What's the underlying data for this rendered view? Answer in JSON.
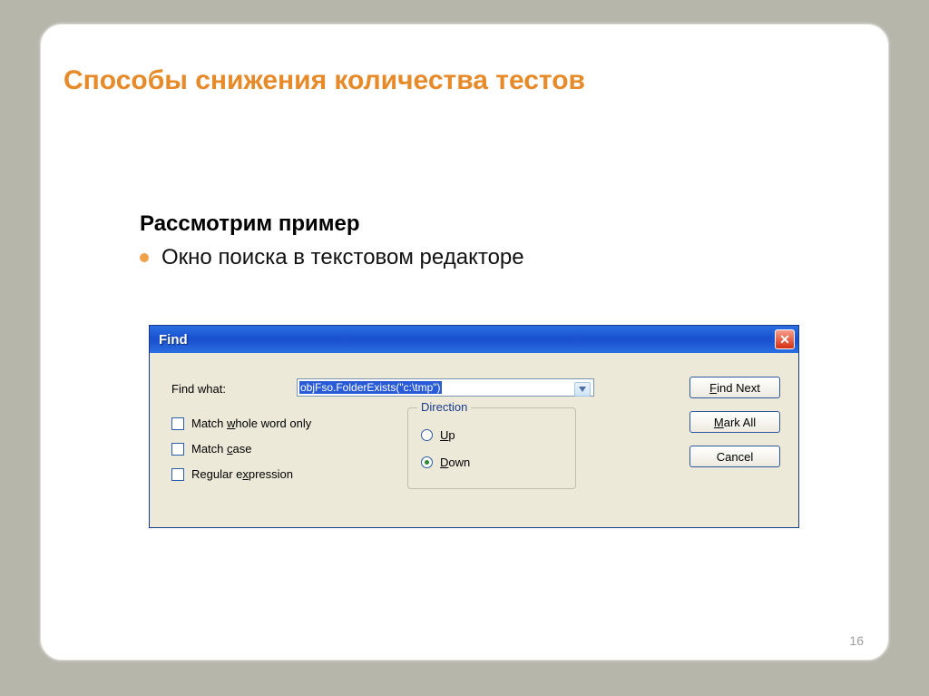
{
  "slide": {
    "title": "Способы снижения количества тестов",
    "subtitle": "Рассмотрим пример",
    "bullet": "Окно поиска в текстовом редакторе",
    "page_number": "16"
  },
  "dialog": {
    "title": "Find",
    "find_what_label": "Find what:",
    "find_value": "objFso.FolderExists(\"c:\\tmp\")",
    "check_match_whole_pre": "Match ",
    "check_match_whole_u": "w",
    "check_match_whole_post": "hole word only",
    "check_match_case_pre": "Match ",
    "check_match_case_u": "c",
    "check_match_case_post": "ase",
    "check_regex_pre": "Regular e",
    "check_regex_u": "x",
    "check_regex_post": "pression",
    "direction_legend": "Direction",
    "radio_up_u": "U",
    "radio_up_post": "p",
    "radio_down_u": "D",
    "radio_down_post": "own",
    "btn_findnext_u": "F",
    "btn_findnext_post": "ind Next",
    "btn_markall_u": "M",
    "btn_markall_post": "ark All",
    "btn_cancel": "Cancel"
  }
}
